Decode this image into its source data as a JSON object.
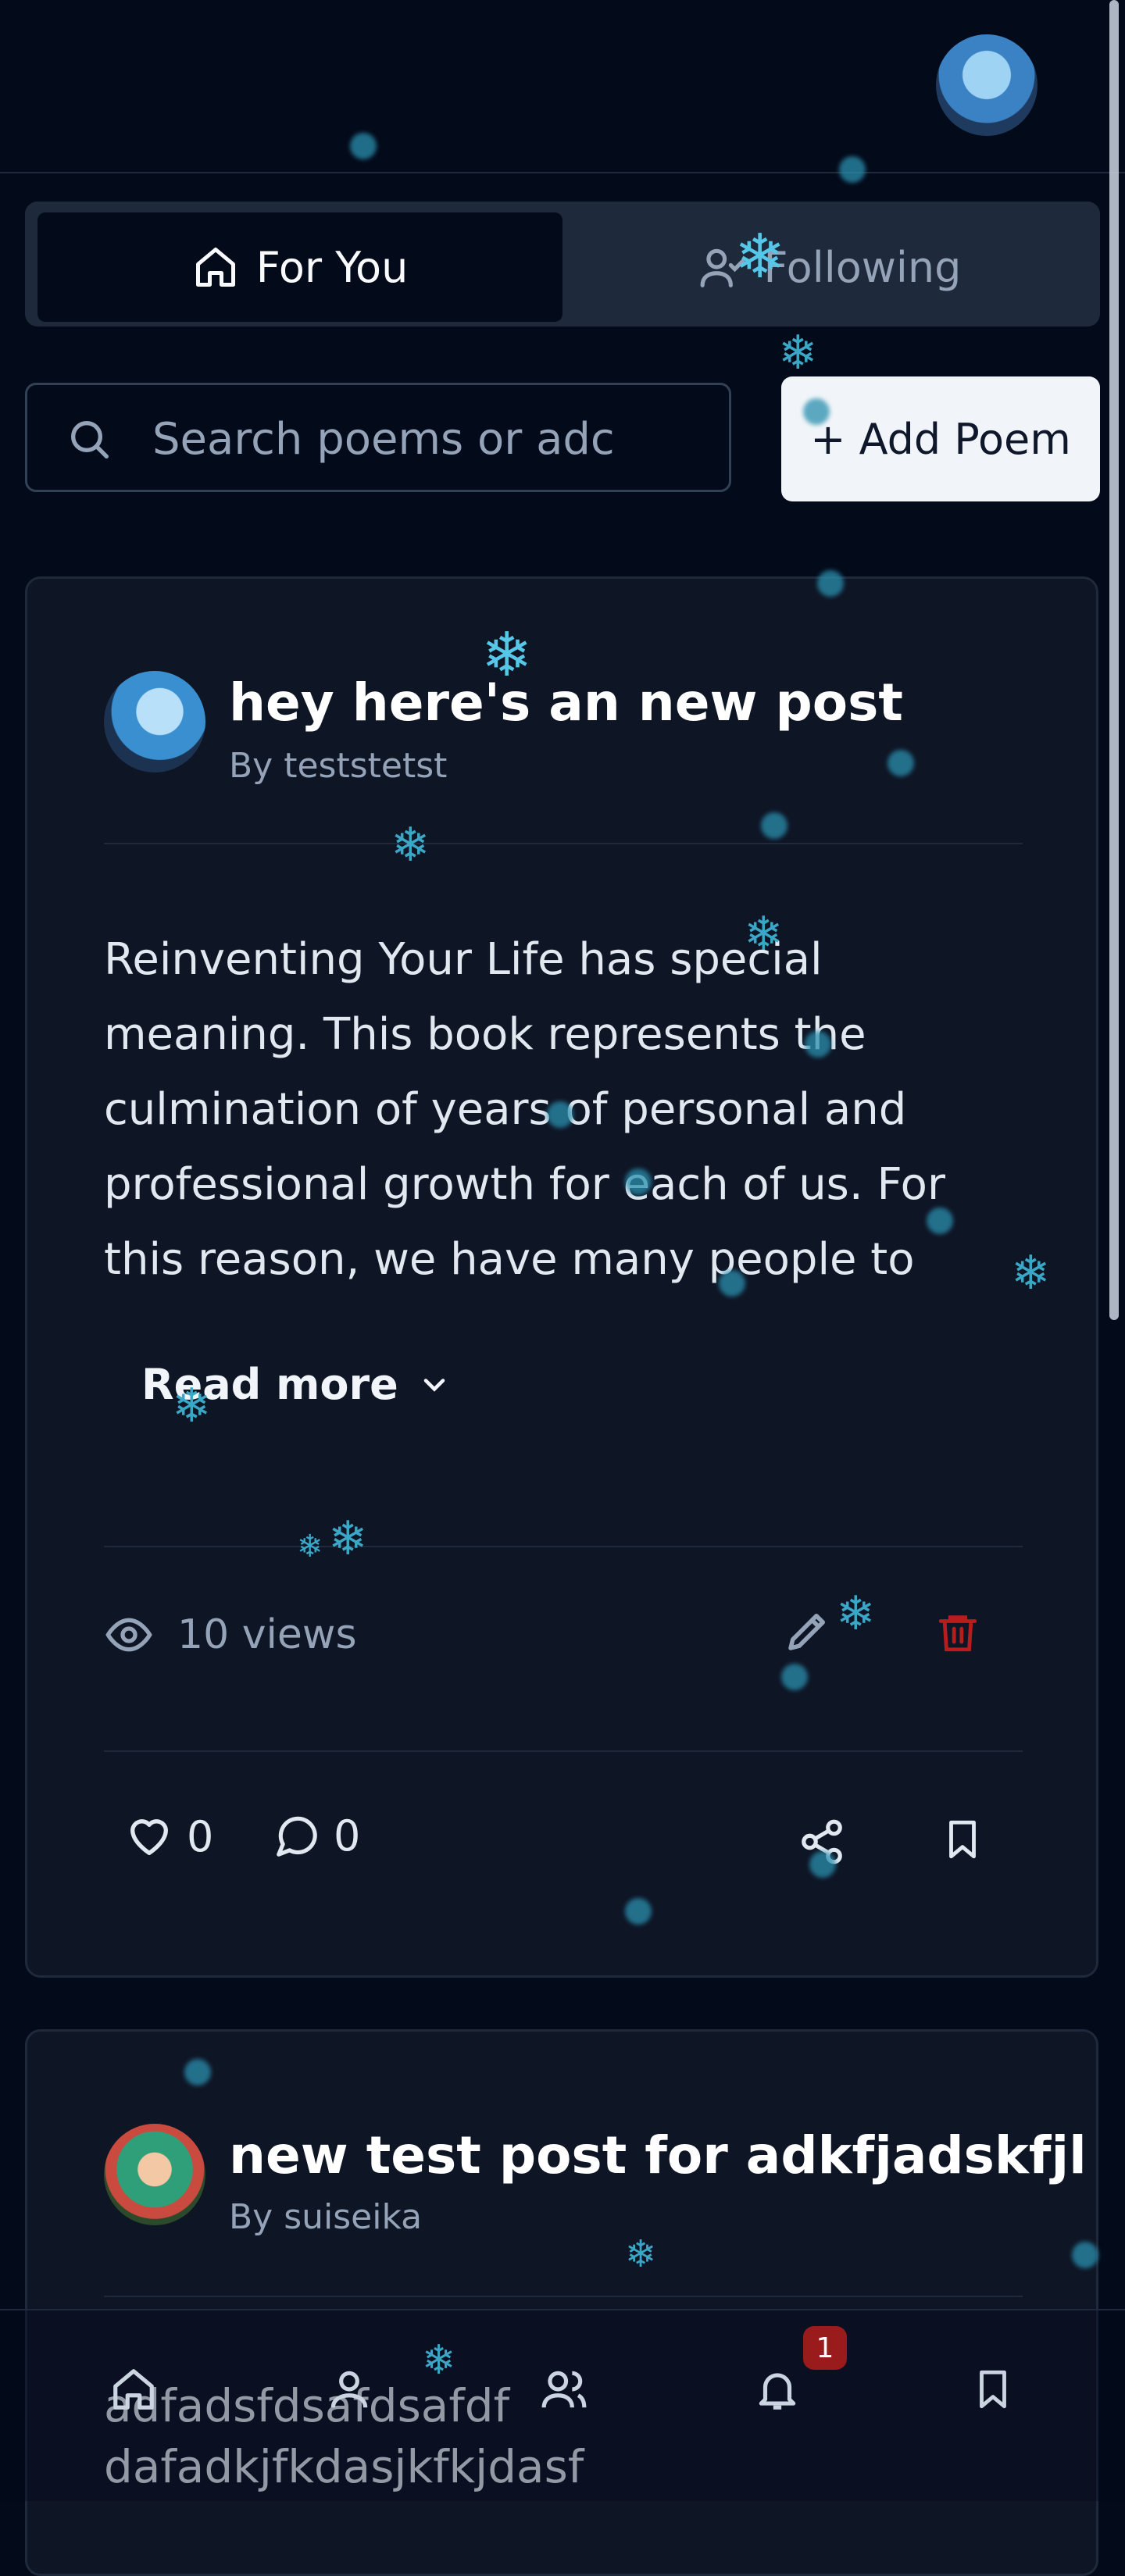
{
  "tabs": [
    {
      "label": "For You",
      "icon": "home-icon",
      "active": true
    },
    {
      "label": "Following",
      "icon": "users-check-icon",
      "active": false
    }
  ],
  "search": {
    "placeholder": "Search poems or adc"
  },
  "add_poem": {
    "label": "+ Add Poem"
  },
  "posts": [
    {
      "title": "hey here's an new post",
      "author": "By teststetst",
      "body": "Reinventing Your Life has special meaning. This book represents the culmination of years of personal and professional growth for each of us. For this reason, we have many people to thank",
      "read_more": "Read more",
      "views": "10 views",
      "likes": "0",
      "comments": "0"
    },
    {
      "title": "new test post for adkfjadskfjl",
      "author": "By suiseika",
      "body_lines": [
        "adfadsfdsafdsafdf",
        "dafadkjfkdasjkfkjdasf"
      ]
    }
  ],
  "notifications": {
    "badge": "1"
  },
  "colors": {
    "background": "#030a1a",
    "card": "#0e1525",
    "danger": "#b91c1c",
    "snow": "#56c7e6"
  }
}
